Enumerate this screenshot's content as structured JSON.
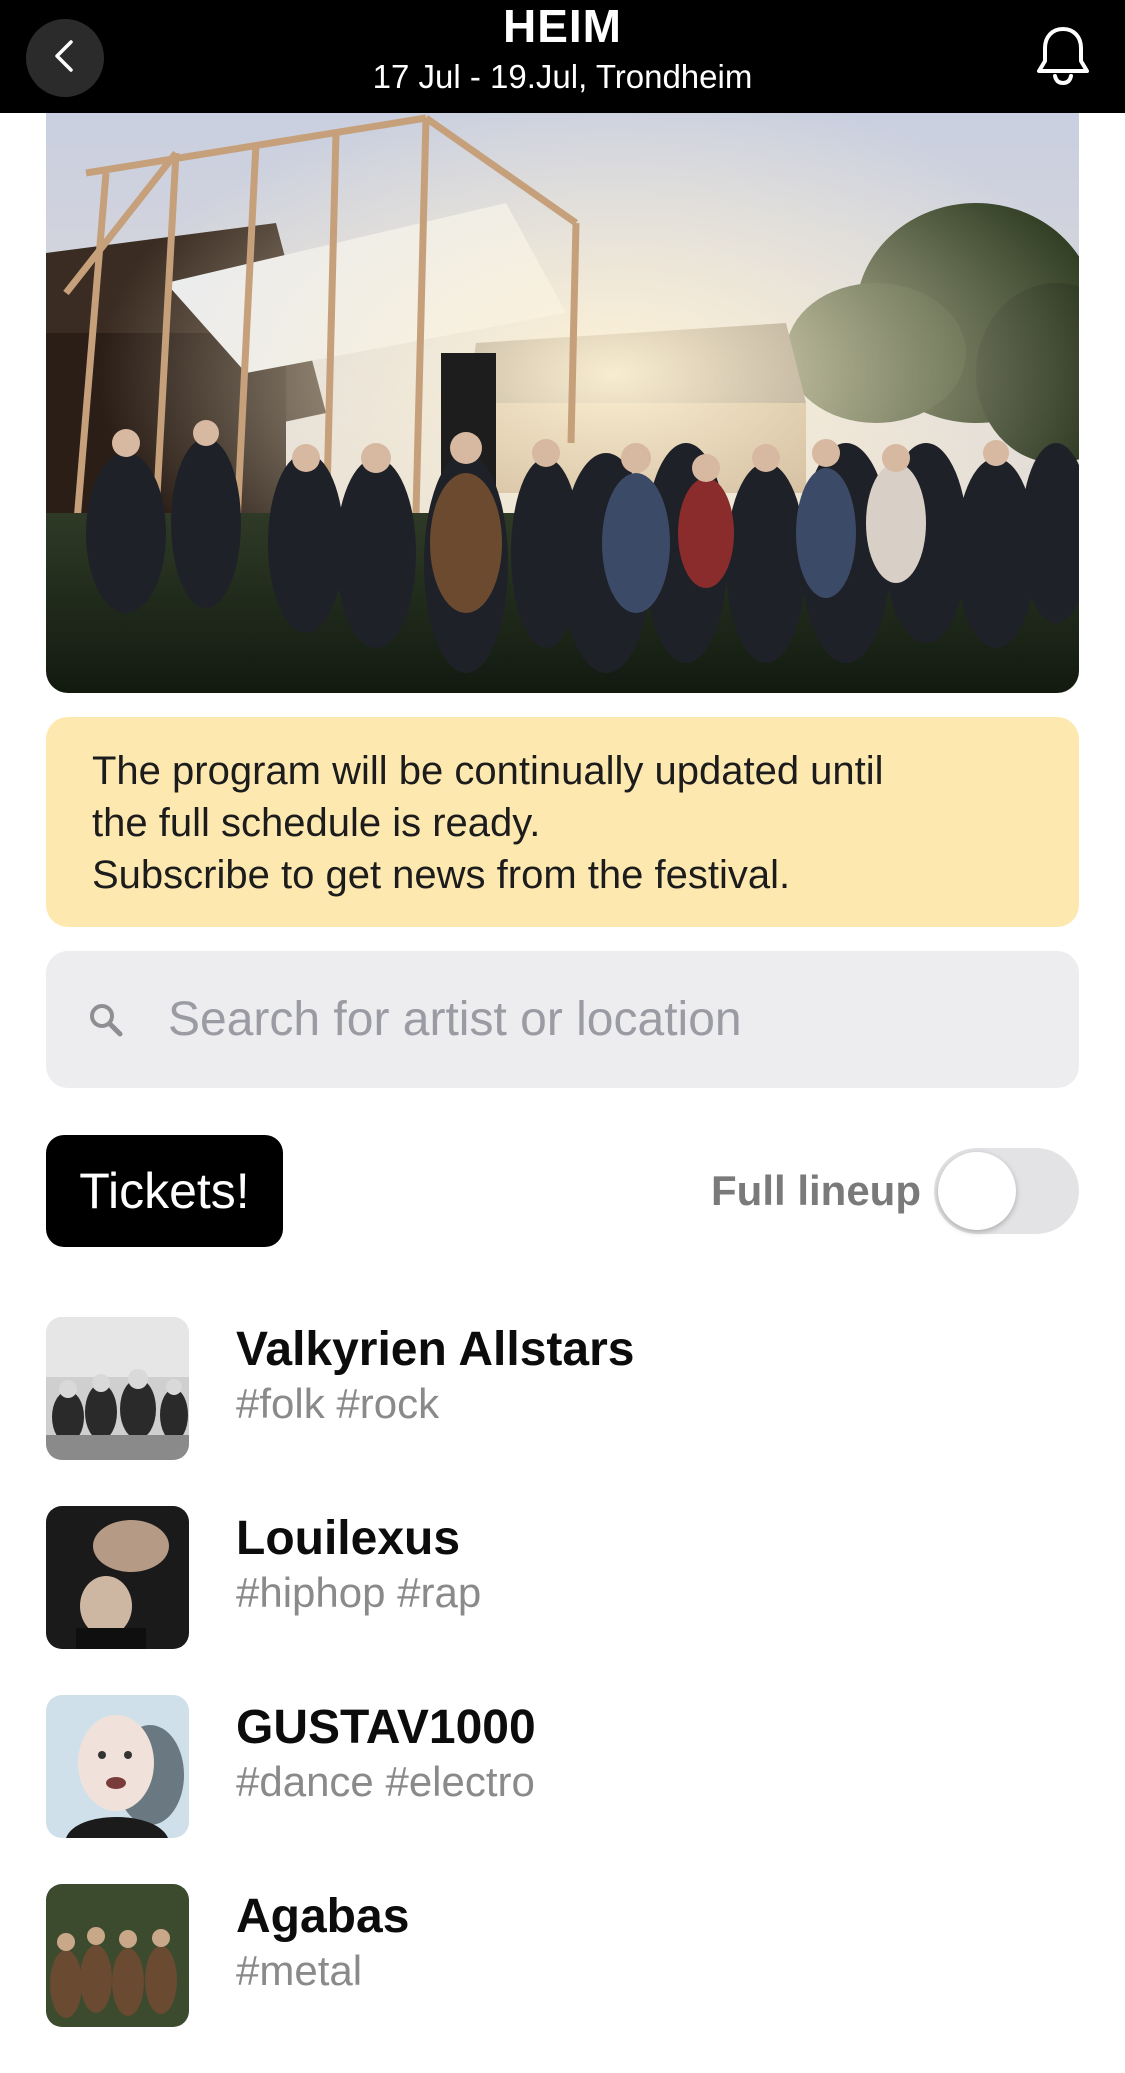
{
  "header": {
    "title": "HEIM",
    "subtitle": "17 Jul - 19.Jul, Trondheim",
    "back_icon": "chevron-left-icon",
    "bell_icon": "bell-icon"
  },
  "notice": {
    "lines": [
      "The program will be continually updated until",
      "the full schedule is ready.",
      "Subscribe to get news from the festival."
    ],
    "background": "#fde9b0"
  },
  "search": {
    "placeholder": "Search for artist or location",
    "value": "",
    "icon": "search-icon"
  },
  "tickets": {
    "label": "Tickets!"
  },
  "lineup_toggle": {
    "label": "Full lineup",
    "on": false
  },
  "artists": [
    {
      "name": "Valkyrien Allstars",
      "tags": "#folk #rock"
    },
    {
      "name": "Louilexus",
      "tags": "#hiphop #rap"
    },
    {
      "name": "GUSTAV1000",
      "tags": "#dance #electro"
    },
    {
      "name": "Agabas",
      "tags": "#metal"
    }
  ],
  "colors": {
    "header_bg": "#000000",
    "accent": "#000000",
    "muted_text": "#8a8a8a"
  }
}
